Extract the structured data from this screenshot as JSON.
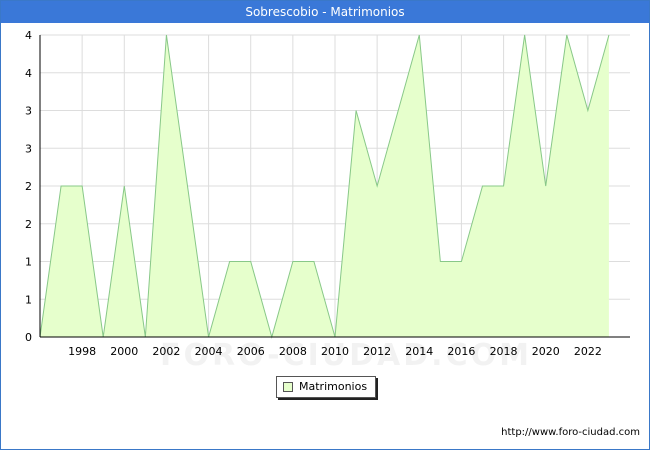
{
  "header": {
    "title": "Sobrescobio - Matrimonios"
  },
  "footer": {
    "url": "http://www.foro-ciudad.com"
  },
  "watermark": "FORO-CIUDAD.COM",
  "legend": {
    "label": "Matrimonios"
  },
  "colors": {
    "fill": "#e6ffcc",
    "line": "#88c888",
    "title_bg": "#3a78d8",
    "grid": "#dddddd"
  },
  "chart_data": {
    "type": "area",
    "title": "Sobrescobio - Matrimonios",
    "xlabel": "",
    "ylabel": "",
    "x": [
      1996,
      1997,
      1998,
      1999,
      2000,
      2001,
      2002,
      2003,
      2004,
      2005,
      2006,
      2007,
      2008,
      2009,
      2010,
      2011,
      2012,
      2013,
      2014,
      2015,
      2016,
      2017,
      2018,
      2019,
      2020,
      2021,
      2022,
      2023
    ],
    "series": [
      {
        "name": "Matrimonios",
        "values": [
          0,
          2,
          2,
          0,
          2,
          0,
          4,
          2,
          0,
          1,
          1,
          0,
          1,
          1,
          0,
          3,
          2,
          3,
          4,
          1,
          1,
          2,
          2,
          4,
          2,
          4,
          3,
          4
        ]
      }
    ],
    "xticks": [
      1998,
      2000,
      2002,
      2004,
      2006,
      2008,
      2010,
      2012,
      2014,
      2016,
      2018,
      2020,
      2022
    ],
    "yticks": [
      0,
      0.5,
      1,
      1.5,
      2,
      2.5,
      3,
      3.5,
      4
    ],
    "ytick_labels": [
      "0",
      "1",
      "1",
      "2",
      "2",
      "3",
      "3",
      "4",
      "4"
    ],
    "ylim": [
      0,
      4
    ],
    "xlim": [
      1996,
      2024
    ],
    "grid": true,
    "legend_position": "bottom-center"
  }
}
